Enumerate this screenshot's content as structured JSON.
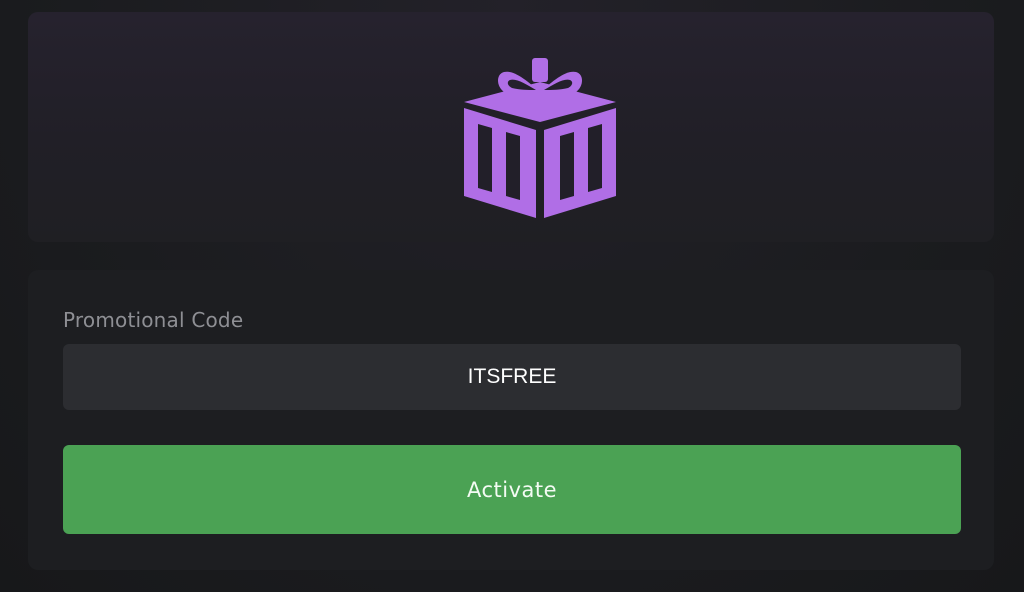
{
  "hero": {
    "icon": "gift-icon",
    "icon_color": "#b06ee6"
  },
  "promo_form": {
    "label": "Promotional Code",
    "code_value": "ITSFREE",
    "activate_label": "Activate",
    "activate_color": "#4ba254"
  }
}
